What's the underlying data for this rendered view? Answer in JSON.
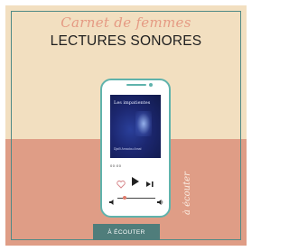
{
  "header": {
    "script_title": "Carnet de femmes",
    "main_title": "LECTURES SONORES"
  },
  "player": {
    "cover_title": "Les impatientes",
    "cover_author": "Djaïli Amadou Amal",
    "time_readout": "00:00",
    "volume_level": 0.2,
    "icons": [
      "heart-icon",
      "play-icon",
      "skip-forward-icon",
      "volume-icon"
    ]
  },
  "side_caption": "à écouter",
  "cta": {
    "label": "À ÉCOUTER"
  },
  "colors": {
    "background_top": "#f2dfc0",
    "background_bottom": "#df9d86",
    "accent_teal": "#4f7d7b",
    "script_pink": "#e59a83"
  }
}
